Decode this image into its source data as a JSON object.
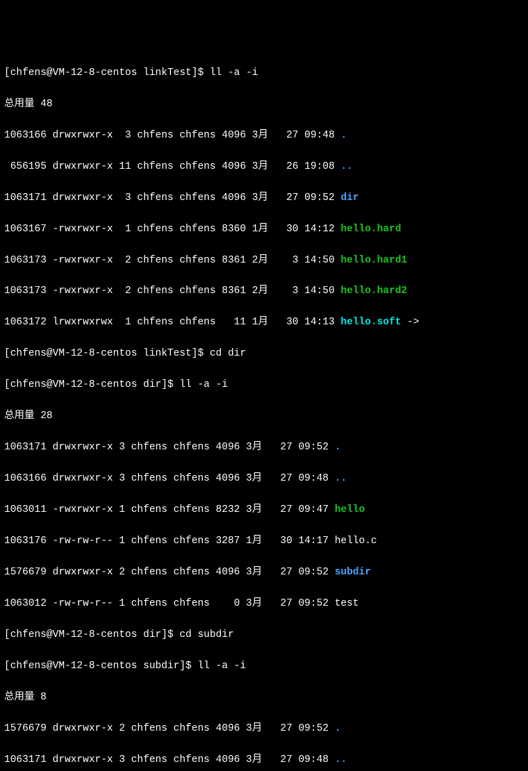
{
  "prompts": {
    "p1": "[chfens@VM-12-8-centos linkTest]$ ",
    "p2": "[chfens@VM-12-8-centos dir]$ ",
    "p3": "[chfens@VM-12-8-centos subdir]$ "
  },
  "cmds": {
    "c1": "ll -a -i",
    "c2": "cd dir",
    "c3": "ll -a -i",
    "c4": "cd subdir",
    "c5": "ll -a -i"
  },
  "totals": {
    "t1": "总用量 48",
    "t2": "总用量 28",
    "t3": "总用量 8"
  },
  "ls1": {
    "r0": {
      "pre": "1063166 drwxrwxr-x  3 chfens chfens 4096 3月   27 09:48 ",
      "name": ".",
      "cls": "dir"
    },
    "r1": {
      "pre": " 656195 drwxrwxr-x 11 chfens chfens 4096 3月   26 19:08 ",
      "name": "..",
      "cls": "dir"
    },
    "r2": {
      "pre": "1063171 drwxrwxr-x  3 chfens chfens 4096 3月   27 09:52 ",
      "name": "dir",
      "cls": "dir"
    },
    "r3": {
      "pre": "1063167 -rwxrwxr-x  1 chfens chfens 8360 1月   30 14:12 ",
      "name": "hello.hard",
      "cls": "exe"
    },
    "r4": {
      "pre": "1063173 -rwxrwxr-x  2 chfens chfens 8361 2月    3 14:50 ",
      "name": "hello.hard1",
      "cls": "exe"
    },
    "r5": {
      "pre": "1063173 -rwxrwxr-x  2 chfens chfens 8361 2月    3 14:50 ",
      "name": "hello.hard2",
      "cls": "exe"
    },
    "r6": {
      "pre": "1063172 lrwxrwxrwx  1 chfens chfens   11 1月   30 14:13 ",
      "name": "hello.soft",
      "cls": "link",
      "suf": " ->"
    }
  },
  "ls2": {
    "r0": {
      "pre": "1063171 drwxrwxr-x 3 chfens chfens 4096 3月   27 09:52 ",
      "name": ".",
      "cls": "dir"
    },
    "r1": {
      "pre": "1063166 drwxrwxr-x 3 chfens chfens 4096 3月   27 09:48 ",
      "name": "..",
      "cls": "dir"
    },
    "r2": {
      "pre": "1063011 -rwxrwxr-x 1 chfens chfens 8232 3月   27 09:47 ",
      "name": "hello",
      "cls": "exe"
    },
    "r3": {
      "pre": "1063176 -rw-rw-r-- 1 chfens chfens 3287 1月   30 14:17 ",
      "name": "hello.c",
      "cls": "plain"
    },
    "r4": {
      "pre": "1576679 drwxrwxr-x 2 chfens chfens 4096 3月   27 09:52 ",
      "name": "subdir",
      "cls": "dir"
    },
    "r5": {
      "pre": "1063012 -rw-rw-r-- 1 chfens chfens    0 3月   27 09:52 ",
      "name": "test",
      "cls": "plain"
    }
  },
  "ls3": {
    "r0": {
      "pre": "1576679 drwxrwxr-x 2 chfens chfens 4096 3月   27 09:52 ",
      "name": ".",
      "cls": "dir"
    },
    "r1": {
      "pre": "1063171 drwxrwxr-x 3 chfens chfens 4096 3月   27 09:48 ",
      "name": "..",
      "cls": "dir"
    }
  }
}
